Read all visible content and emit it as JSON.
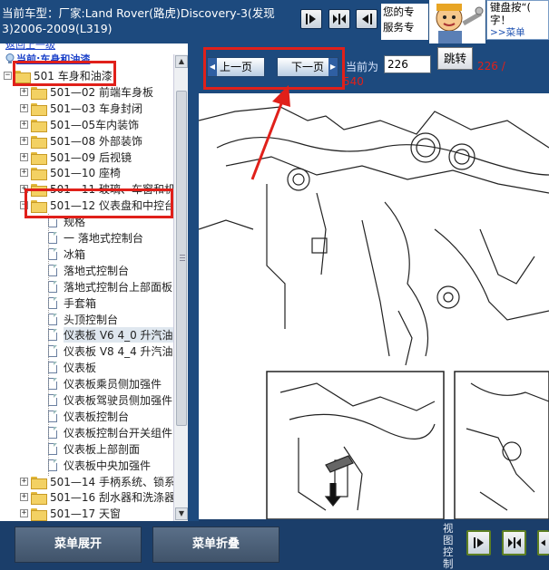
{
  "header": {
    "model_text": "当前车型：厂家:Land Rover(路虎)Discovery-3(发现3)2006-2009(L319)",
    "tip_text_1": "您的专",
    "tip_text_2": "服务专",
    "tip2_line1": "键盘按“(",
    "tip2_line2": "字！",
    "tip2_link": ">>菜单"
  },
  "tree": {
    "crumb_top": "返回上一级",
    "crumb": "当前:车身和油漆",
    "items": [
      {
        "label": "501 车身和油漆",
        "kind": "folder-open"
      },
      {
        "label": "501—02 前端车身板",
        "kind": "folder"
      },
      {
        "label": "501—03 车身封闭",
        "kind": "folder"
      },
      {
        "label": "501—05车内装饰",
        "kind": "folder"
      },
      {
        "label": "501—08 外部装饰",
        "kind": "folder"
      },
      {
        "label": "501—09 后视镜",
        "kind": "folder"
      },
      {
        "label": "501—10 座椅",
        "kind": "folder"
      },
      {
        "label": "501—11 玻璃、车窗和机构",
        "kind": "folder"
      },
      {
        "label": "501—12 仪表盘和中控台",
        "kind": "folder-open"
      },
      {
        "label": "规格",
        "kind": "doc"
      },
      {
        "label": "一 落地式控制台",
        "kind": "doc"
      },
      {
        "label": "冰箱",
        "kind": "doc"
      },
      {
        "label": "落地式控制台",
        "kind": "doc"
      },
      {
        "label": "落地式控制台上部面板",
        "kind": "doc"
      },
      {
        "label": "手套箱",
        "kind": "doc"
      },
      {
        "label": "头顶控制台",
        "kind": "doc"
      },
      {
        "label": "仪表板 V6 4_0 升汽油",
        "kind": "doc",
        "selected": true
      },
      {
        "label": "仪表板 V8 4_4 升汽油",
        "kind": "doc"
      },
      {
        "label": "仪表板",
        "kind": "doc"
      },
      {
        "label": "仪表板乘员侧加强件",
        "kind": "doc"
      },
      {
        "label": "仪表板驾驶员侧加强件",
        "kind": "doc"
      },
      {
        "label": "仪表板控制台",
        "kind": "doc"
      },
      {
        "label": "仪表板控制台开关组件",
        "kind": "doc"
      },
      {
        "label": "仪表板上部剖面",
        "kind": "doc"
      },
      {
        "label": "仪表板中央加强件",
        "kind": "doc"
      },
      {
        "label": "501—14 手柄系统、锁系统",
        "kind": "folder"
      },
      {
        "label": "501—16 刮水器和洗涤器",
        "kind": "folder"
      },
      {
        "label": "501—17 天窗",
        "kind": "folder"
      }
    ]
  },
  "nav": {
    "prev_label": "上一页",
    "next_label": "下一页",
    "current_label": "当前为",
    "page_value": "226",
    "jump_label": "跳转",
    "total_1": "226 /",
    "total_2": "540"
  },
  "bottom": {
    "expand_label": "菜单展开",
    "collapse_label": "菜单折叠",
    "view_control_label": "视图控制"
  },
  "colors": {
    "frame": "#1d4a7e",
    "highlight_red": "#e0201a",
    "link_blue": "#1a40c8"
  }
}
